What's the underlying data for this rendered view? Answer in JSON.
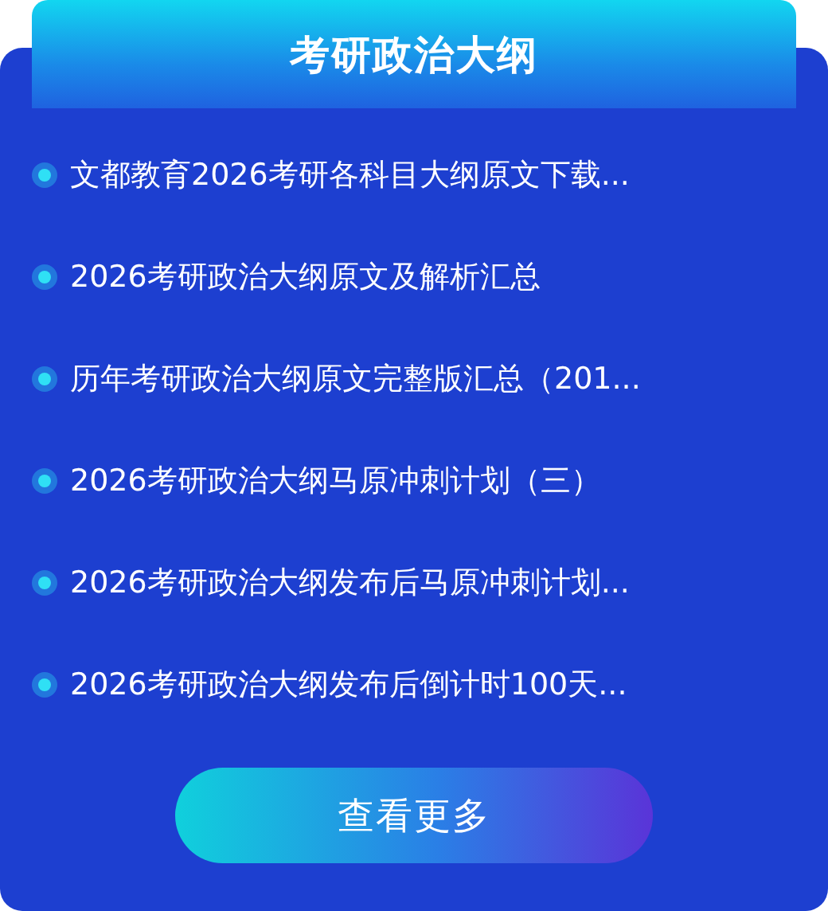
{
  "title": "考研政治大纲",
  "items": [
    {
      "text": "文都教育2026考研各科目大纲原文下载..."
    },
    {
      "text": "2026考研政治大纲原文及解析汇总"
    },
    {
      "text": "历年考研政治大纲原文完整版汇总（201..."
    },
    {
      "text": "2026考研政治大纲马原冲刺计划（三）"
    },
    {
      "text": "2026考研政治大纲发布后马原冲刺计划..."
    },
    {
      "text": "2026考研政治大纲发布后倒计时100天..."
    }
  ],
  "more_button": "查看更多"
}
